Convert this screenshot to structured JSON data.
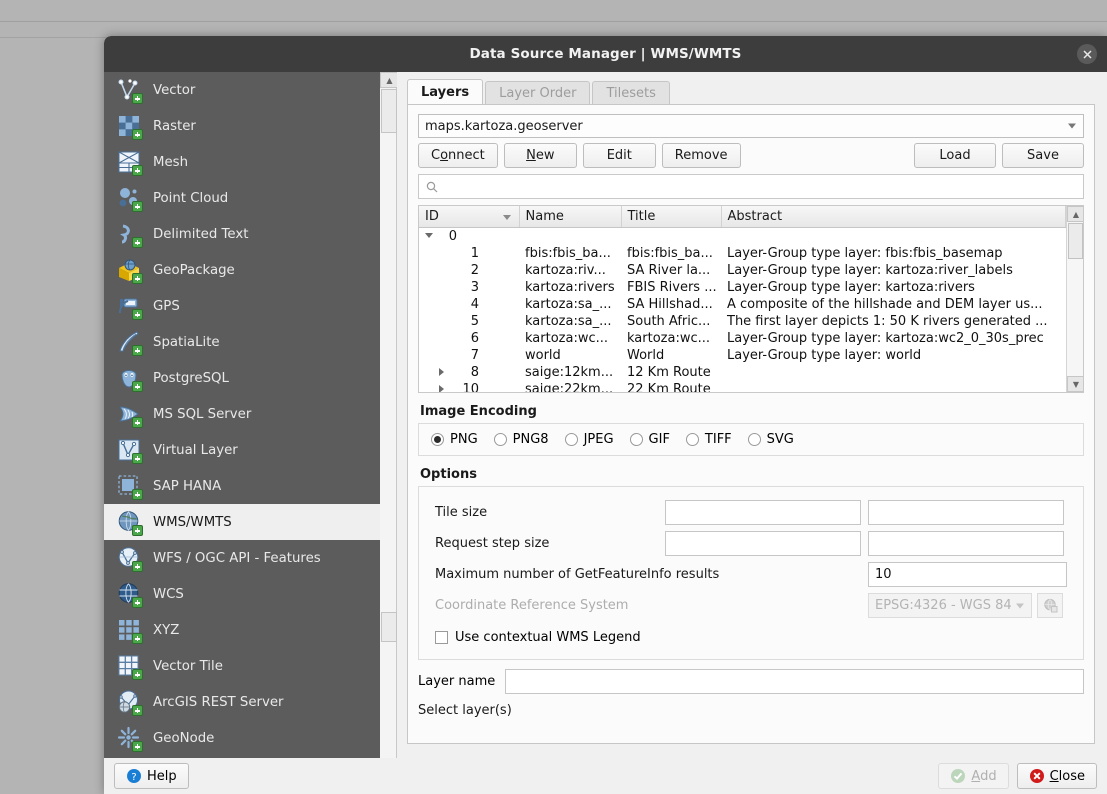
{
  "window": {
    "title": "Data Source Manager | WMS/WMTS",
    "close_icon": "close-icon"
  },
  "sidebar": {
    "items": [
      {
        "label": "Vector",
        "icon": "vector-icon"
      },
      {
        "label": "Raster",
        "icon": "raster-icon"
      },
      {
        "label": "Mesh",
        "icon": "mesh-icon"
      },
      {
        "label": "Point Cloud",
        "icon": "point-cloud-icon"
      },
      {
        "label": "Delimited Text",
        "icon": "delimited-text-icon"
      },
      {
        "label": "GeoPackage",
        "icon": "geopackage-icon"
      },
      {
        "label": "GPS",
        "icon": "gps-icon"
      },
      {
        "label": "SpatiaLite",
        "icon": "spatialite-icon"
      },
      {
        "label": "PostgreSQL",
        "icon": "postgresql-icon"
      },
      {
        "label": "MS SQL Server",
        "icon": "mssql-icon"
      },
      {
        "label": "Virtual Layer",
        "icon": "virtual-layer-icon"
      },
      {
        "label": "SAP HANA",
        "icon": "sap-hana-icon"
      },
      {
        "label": "WMS/WMTS",
        "icon": "wms-icon",
        "selected": true
      },
      {
        "label": "WFS / OGC API - Features",
        "icon": "wfs-icon"
      },
      {
        "label": "WCS",
        "icon": "wcs-icon"
      },
      {
        "label": "XYZ",
        "icon": "xyz-icon"
      },
      {
        "label": "Vector Tile",
        "icon": "vector-tile-icon"
      },
      {
        "label": "ArcGIS REST Server",
        "icon": "arcgis-rest-icon"
      },
      {
        "label": "GeoNode",
        "icon": "geonode-icon"
      }
    ]
  },
  "tabs": [
    {
      "label": "Layers",
      "active": true,
      "enabled": true
    },
    {
      "label": "Layer Order",
      "active": false,
      "enabled": false
    },
    {
      "label": "Tilesets",
      "active": false,
      "enabled": false
    }
  ],
  "connection": {
    "selected": "maps.kartoza.geoserver",
    "buttons": [
      {
        "label": "Connect",
        "mnemonic": "o"
      },
      {
        "label": "New",
        "mnemonic": "N"
      },
      {
        "label": "Edit",
        "mnemonic": ""
      },
      {
        "label": "Remove",
        "mnemonic": ""
      }
    ],
    "right_buttons": [
      {
        "label": "Load"
      },
      {
        "label": "Save"
      }
    ]
  },
  "search": {
    "value": "",
    "placeholder": "",
    "icon": "search-icon"
  },
  "layers_table": {
    "columns": [
      "ID",
      "Name",
      "Title",
      "Abstract"
    ],
    "sorted_column": "ID",
    "sort_direction": "desc",
    "rows": [
      {
        "indent": 0,
        "expander": "down",
        "id": "0",
        "name": "",
        "title": "",
        "abstract": ""
      },
      {
        "indent": 1,
        "expander": "none",
        "id": "1",
        "name": "fbis:fbis_ba...",
        "title": "fbis:fbis_ba...",
        "abstract": "Layer-Group type layer: fbis:fbis_basemap"
      },
      {
        "indent": 1,
        "expander": "none",
        "id": "2",
        "name": "kartoza:riv...",
        "title": "SA River la...",
        "abstract": "Layer-Group type layer: kartoza:river_labels"
      },
      {
        "indent": 1,
        "expander": "none",
        "id": "3",
        "name": "kartoza:rivers",
        "title": "FBIS Rivers ...",
        "abstract": "Layer-Group type layer: kartoza:rivers"
      },
      {
        "indent": 1,
        "expander": "none",
        "id": "4",
        "name": "kartoza:sa_...",
        "title": "SA Hillshad...",
        "abstract": "A composite of the hillshade and DEM layer us..."
      },
      {
        "indent": 1,
        "expander": "none",
        "id": "5",
        "name": "kartoza:sa_...",
        "title": "South Afric...",
        "abstract": "The first layer depicts 1: 50 K rivers generated ..."
      },
      {
        "indent": 1,
        "expander": "none",
        "id": "6",
        "name": "kartoza:wc...",
        "title": "kartoza:wc...",
        "abstract": "Layer-Group type layer: kartoza:wc2_0_30s_prec"
      },
      {
        "indent": 1,
        "expander": "none",
        "id": "7",
        "name": "world",
        "title": "World",
        "abstract": "Layer-Group type layer: world"
      },
      {
        "indent": 1,
        "expander": "right",
        "id": "8",
        "name": "saige:12km...",
        "title": "12 Km Route",
        "abstract": ""
      },
      {
        "indent": 1,
        "expander": "right",
        "id": "10",
        "name": "saige:22km...",
        "title": "22 Km Route",
        "abstract": ""
      }
    ]
  },
  "image_encoding": {
    "heading": "Image Encoding",
    "options": [
      {
        "label": "PNG",
        "selected": true
      },
      {
        "label": "PNG8",
        "selected": false
      },
      {
        "label": "JPEG",
        "selected": false
      },
      {
        "label": "GIF",
        "selected": false
      },
      {
        "label": "TIFF",
        "selected": false
      },
      {
        "label": "SVG",
        "selected": false
      }
    ]
  },
  "options": {
    "heading": "Options",
    "tile_size": {
      "label": "Tile size",
      "width": "",
      "height": ""
    },
    "request_step_size": {
      "label": "Request step size",
      "width": "",
      "height": ""
    },
    "max_getfeatureinfo": {
      "label": "Maximum number of GetFeatureInfo results",
      "value": "10"
    },
    "crs": {
      "label": "Coordinate Reference System",
      "value": "EPSG:4326 - WGS 84",
      "enabled": false,
      "button_icon": "crs-globe-icon"
    },
    "contextual_legend": {
      "label": "Use contextual WMS Legend",
      "checked": false
    }
  },
  "layer_name": {
    "label": "Layer name",
    "value": "",
    "placeholder": ""
  },
  "select_layers_hint": "Select layer(s)",
  "footer": {
    "help": {
      "label": "Help",
      "icon": "help-icon"
    },
    "add": {
      "label": "Add",
      "mnemonic": "A",
      "icon": "add-check-icon",
      "enabled": false
    },
    "close": {
      "label": "Close",
      "mnemonic": "C",
      "icon": "close-circle-icon",
      "enabled": true
    }
  },
  "colors": {
    "titlebar": "#3d3d3d",
    "sidebar": "#5c5c5c",
    "sidebar_selected": "#efefef",
    "dialog_bg": "#f0f0f0",
    "panel_bg": "#fbfbfb",
    "desktop_bg": "#b4b4b4",
    "accent_green": "#4aa84a",
    "close_red": "#d11a1a",
    "help_blue": "#1a7fd4"
  }
}
